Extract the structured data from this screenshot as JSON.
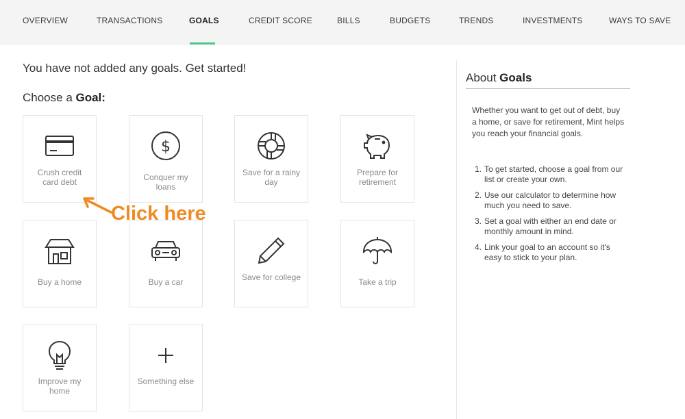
{
  "nav": {
    "tabs": [
      {
        "label": "OVERVIEW"
      },
      {
        "label": "TRANSACTIONS"
      },
      {
        "label": "GOALS",
        "active": true
      },
      {
        "label": "CREDIT SCORE"
      },
      {
        "label": "BILLS"
      },
      {
        "label": "BUDGETS"
      },
      {
        "label": "TRENDS"
      },
      {
        "label": "INVESTMENTS"
      },
      {
        "label": "WAYS TO SAVE"
      }
    ],
    "active_color": "#4cc686"
  },
  "main": {
    "heading": "You have not added any goals. Get started!",
    "choose_prefix": "Choose a ",
    "choose_bold": "Goal:",
    "goals": [
      {
        "label": "Crush credit card debt",
        "icon": "credit-card-icon"
      },
      {
        "label": "Conquer my loans",
        "icon": "dollar-coin-icon"
      },
      {
        "label": "Save for a rainy day",
        "icon": "life-ring-icon"
      },
      {
        "label": "Prepare for retirement",
        "icon": "piggy-bank-icon"
      },
      {
        "label": "Buy a home",
        "icon": "house-icon"
      },
      {
        "label": "Buy a car",
        "icon": "car-icon"
      },
      {
        "label": "Save for college",
        "icon": "pencil-icon"
      },
      {
        "label": "Take a trip",
        "icon": "umbrella-icon"
      },
      {
        "label": "Improve my home",
        "icon": "lightbulb-icon"
      },
      {
        "label": "Something else",
        "icon": "plus-icon"
      }
    ]
  },
  "about": {
    "title_prefix": "About ",
    "title_bold": "Goals",
    "intro": "Whether you want to get out of debt, buy a home, or save for retirement, Mint helps you reach your financial goals.",
    "steps": [
      {
        "num": "1.",
        "text": "To get started, choose a goal from our list or create your own."
      },
      {
        "num": "2.",
        "text": "Use our calculator to determine how much you need to save."
      },
      {
        "num": "3.",
        "text": "Set a goal with either an end date or monthly amount in mind."
      },
      {
        "num": "4.",
        "text": "Link your goal to an account so it's easy to stick to your plan."
      }
    ]
  },
  "annotation": {
    "text": "Click here",
    "color": "#f08a24"
  }
}
